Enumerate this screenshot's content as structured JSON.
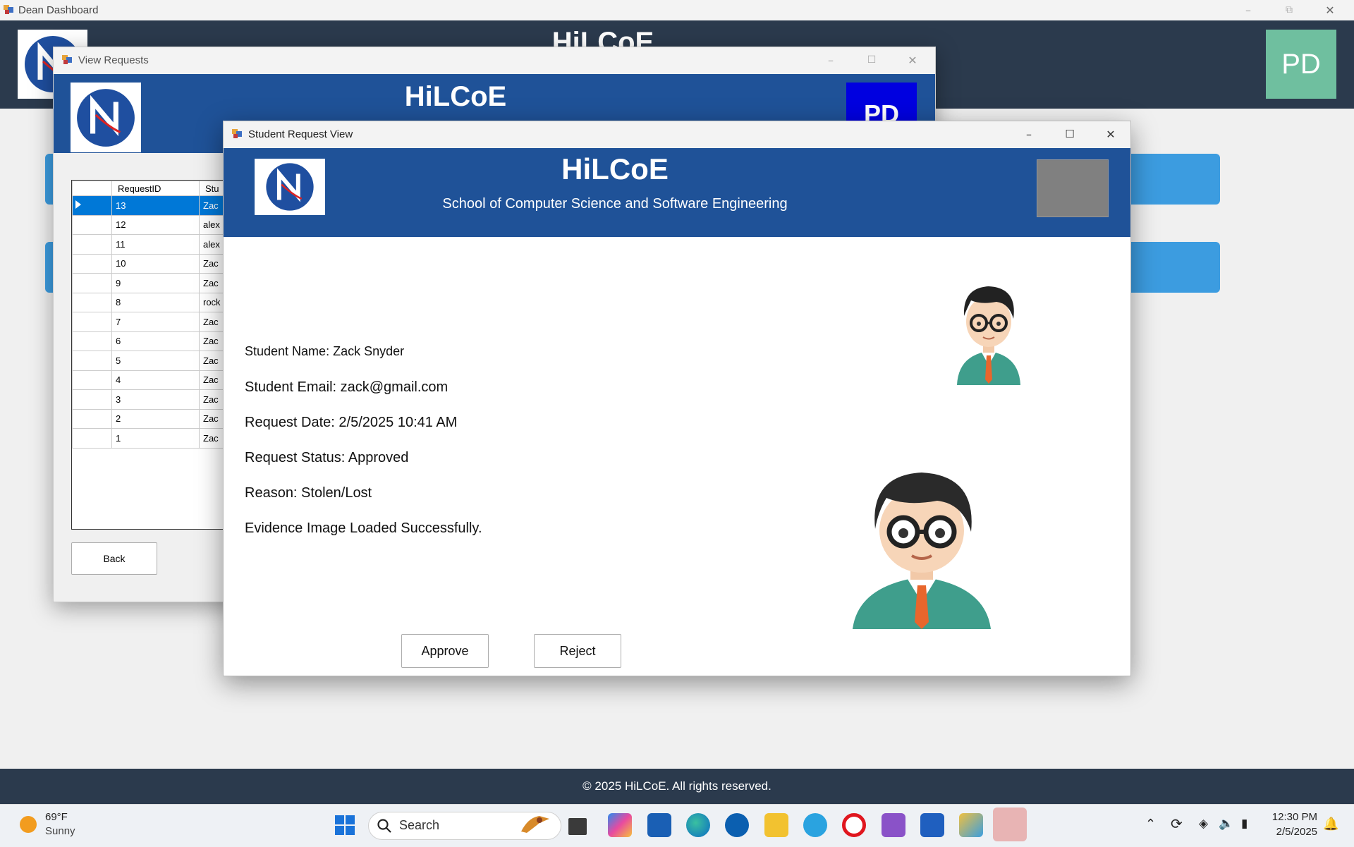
{
  "dean_window": {
    "title": "Dean Dashboard",
    "header_title": "HiLCoE",
    "avatar_initials": "PD",
    "footer": "© 2025 HiLCoE. All rights reserved."
  },
  "view_requests_window": {
    "title": "View Requests",
    "header_title": "HiLCoE",
    "avatar_initials": "PD",
    "grid": {
      "columns": [
        "RequestID",
        "Stu"
      ],
      "rows": [
        {
          "id": "13",
          "student": "Zac"
        },
        {
          "id": "12",
          "student": "alex"
        },
        {
          "id": "11",
          "student": "alex"
        },
        {
          "id": "10",
          "student": "Zac"
        },
        {
          "id": "9",
          "student": "Zac"
        },
        {
          "id": "8",
          "student": "rock"
        },
        {
          "id": "7",
          "student": "Zac"
        },
        {
          "id": "6",
          "student": "Zac"
        },
        {
          "id": "5",
          "student": "Zac"
        },
        {
          "id": "4",
          "student": "Zac"
        },
        {
          "id": "3",
          "student": "Zac"
        },
        {
          "id": "2",
          "student": "Zac"
        },
        {
          "id": "1",
          "student": "Zac"
        }
      ],
      "selected_id": "13"
    },
    "back_label": "Back"
  },
  "student_request_window": {
    "title": "Student Request View",
    "header_title": "HiLCoE",
    "header_subtitle": "School of Computer Science and Software Engineering",
    "student_name": "Student Name: Zack Snyder",
    "student_email": "Student Email: zack@gmail.com",
    "request_date": "Request Date: 2/5/2025 10:41 AM",
    "request_status": "Request Status: Approved",
    "reason": "Reason: Stolen/Lost",
    "evidence_status": "Evidence Image Loaded Successfully.",
    "approve_label": "Approve",
    "reject_label": "Reject"
  },
  "taskbar": {
    "temperature": "69°F",
    "condition": "Sunny",
    "search_label": "Search",
    "time": "12:30 PM",
    "date": "2/5/2025"
  },
  "colors": {
    "header_blue": "#1f5298",
    "dashboard_dark": "#2b3a4d",
    "accent_button": "#3c9ce0",
    "pd_green": "#6fbf9f",
    "pd_blue": "#0000e0",
    "selected_row": "#0078d7"
  }
}
